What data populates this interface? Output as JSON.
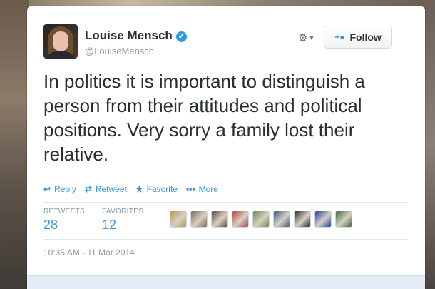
{
  "author": {
    "name": "Louise Mensch",
    "handle": "@LouiseMensch",
    "verified_mark": "✔"
  },
  "header": {
    "settings_icon": "gear-icon",
    "follow_label": "Follow"
  },
  "tweet": {
    "text": "In politics it is important to distinguish a person from their attitudes and political positions. Very sorry a family lost their relative."
  },
  "actions": {
    "reply": "Reply",
    "retweet": "Retweet",
    "favorite": "Favorite",
    "more": "More"
  },
  "stats": {
    "retweets_label": "RETWEETS",
    "retweets_count": "28",
    "favorites_label": "FAVORITES",
    "favorites_count": "12"
  },
  "favoriters": {
    "count": 9,
    "colors": [
      "#b89a52",
      "#7d6b5e",
      "#5a4a44",
      "#b0473a",
      "#6f8a4a",
      "#3e5a8a",
      "#2a2a2a",
      "#1f3fa8",
      "#3a6a3a"
    ]
  },
  "timestamp": "10:35 AM - 11 Mar 2014",
  "colors": {
    "link": "#3b94d9",
    "text": "#292f33",
    "muted": "#8899a6",
    "verified": "#2b9ae8"
  }
}
